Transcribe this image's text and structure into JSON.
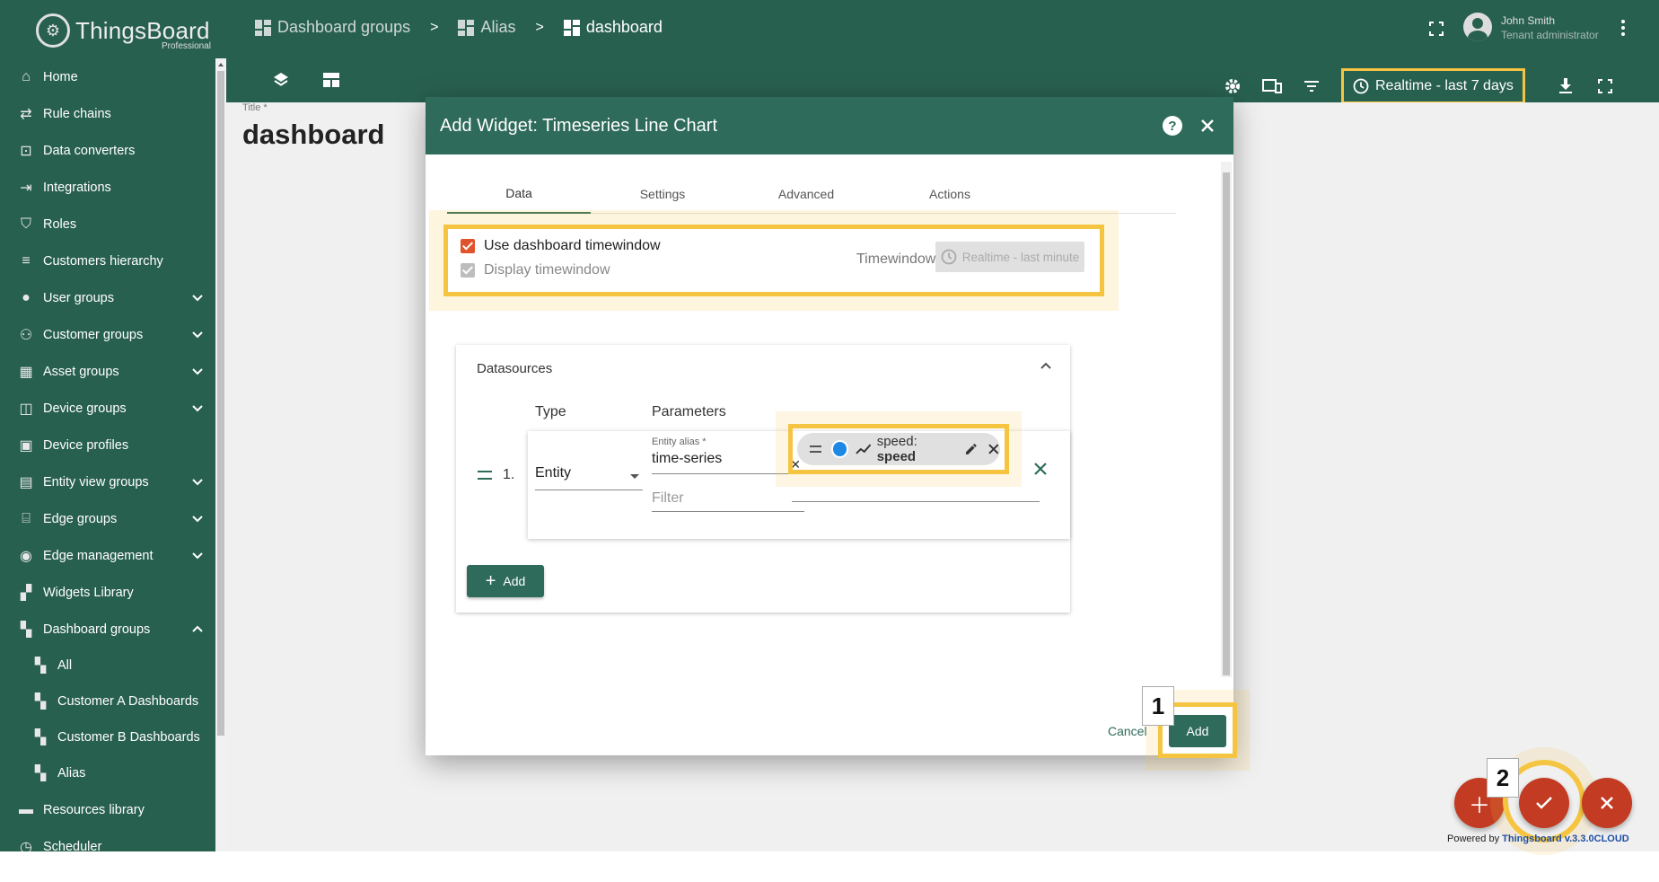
{
  "app": {
    "name": "ThingsBoard",
    "edition": "Professional"
  },
  "breadcrumb": [
    "Dashboard groups",
    "Alias",
    "dashboard"
  ],
  "user": {
    "name": "John Smith",
    "role": "Tenant administrator"
  },
  "toolbar": {
    "timewindow": "Realtime - last 7 days"
  },
  "sidebar": {
    "items": [
      {
        "label": "Home",
        "icon": "home-icon"
      },
      {
        "label": "Rule chains",
        "icon": "rule-chain-icon"
      },
      {
        "label": "Data converters",
        "icon": "converter-icon"
      },
      {
        "label": "Integrations",
        "icon": "integration-icon"
      },
      {
        "label": "Roles",
        "icon": "shield-icon"
      },
      {
        "label": "Customers hierarchy",
        "icon": "hierarchy-icon"
      },
      {
        "label": "User groups",
        "icon": "user-icon",
        "expandable": true
      },
      {
        "label": "Customer groups",
        "icon": "customers-icon",
        "expandable": true
      },
      {
        "label": "Asset groups",
        "icon": "asset-icon",
        "expandable": true
      },
      {
        "label": "Device groups",
        "icon": "device-icon",
        "expandable": true
      },
      {
        "label": "Device profiles",
        "icon": "device-profile-icon"
      },
      {
        "label": "Entity view groups",
        "icon": "entity-view-icon",
        "expandable": true
      },
      {
        "label": "Edge groups",
        "icon": "edge-icon",
        "expandable": true
      },
      {
        "label": "Edge management",
        "icon": "antenna-icon",
        "expandable": true
      },
      {
        "label": "Widgets Library",
        "icon": "widgets-icon"
      },
      {
        "label": "Dashboard groups",
        "icon": "dashboard-icon",
        "expanded": true
      }
    ],
    "subitems": [
      "All",
      "Customer A Dashboards",
      "Customer B Dashboards",
      "Alias"
    ],
    "after": [
      {
        "label": "Resources library",
        "icon": "folder-icon"
      },
      {
        "label": "Scheduler",
        "icon": "clock-icon"
      }
    ]
  },
  "dashboard": {
    "title_label": "Title *",
    "title": "dashboard"
  },
  "dialog": {
    "title": "Add Widget: Timeseries Line Chart",
    "tabs": [
      "Data",
      "Settings",
      "Advanced",
      "Actions"
    ],
    "use_dashboard_timewindow": "Use dashboard timewindow",
    "display_timewindow": "Display timewindow",
    "timewindow_label": "Timewindow",
    "timewindow_value": "Realtime - last minute",
    "datasources_title": "Datasources",
    "col_type": "Type",
    "col_params": "Parameters",
    "row_index": "1.",
    "type_value": "Entity",
    "alias_label": "Entity alias *",
    "alias_value": "time-series",
    "filter_placeholder": "Filter",
    "key_prefix": "speed: ",
    "key_name": "speed",
    "add_label": "Add",
    "cancel_label": "Cancel",
    "confirm_label": "Add"
  },
  "markers": [
    "1",
    "2"
  ],
  "footer": {
    "powered_by": "Powered by",
    "brand": "Thingsboard v.3.3.0CLOUD"
  },
  "colors": {
    "primary": "#2f6b5a",
    "sidebar": "#28604f",
    "highlight": "#f5c542",
    "fab": "#c23b22",
    "checkbox": "#e0532b",
    "series": "#1e88e5"
  }
}
